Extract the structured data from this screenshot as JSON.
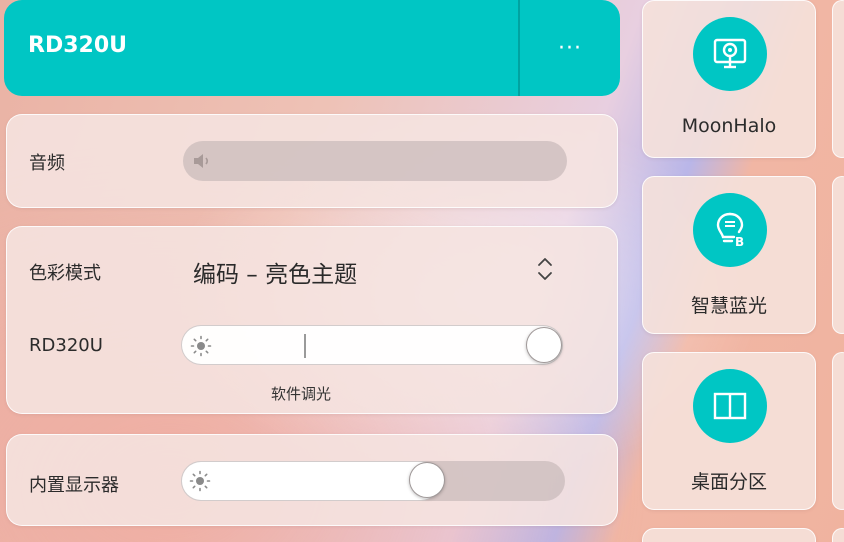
{
  "header": {
    "title": "RD320U",
    "more_label": "···"
  },
  "audio": {
    "label": "音频",
    "icon": "speaker-icon",
    "volume_level": 0
  },
  "color_mode": {
    "label": "色彩模式",
    "selected": "编码 – 亮色主题",
    "icon": "chevron-updown-icon"
  },
  "brightness_external": {
    "label": "RD320U",
    "icon": "sun-icon",
    "level": 1.0,
    "caption": "软件调光"
  },
  "brightness_internal": {
    "label": "内置显示器",
    "icon": "sun-icon",
    "level": 0.64
  },
  "tiles": [
    {
      "label": "MoonHalo",
      "icon": "moonhalo-icon"
    },
    {
      "label": "智慧蓝光",
      "icon": "smart-bluelight-icon"
    },
    {
      "label": "桌面分区",
      "icon": "desktop-partition-icon"
    }
  ],
  "colors": {
    "accent": "#00c6c4",
    "card": "#f5e4e0"
  }
}
